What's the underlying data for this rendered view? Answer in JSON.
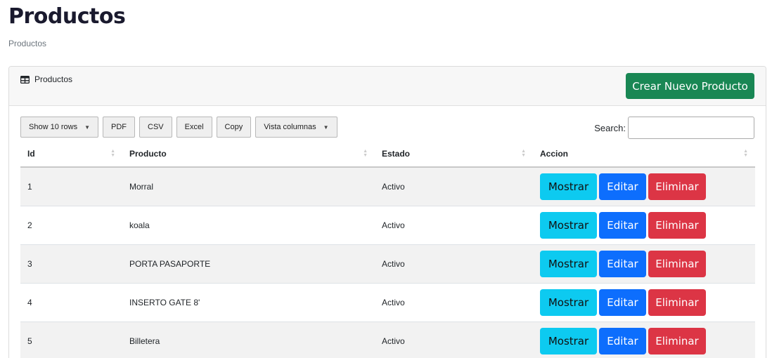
{
  "page": {
    "title": "Productos",
    "breadcrumb": "Productos"
  },
  "card": {
    "header_title": "Productos",
    "create_button": "Crear Nuevo Producto"
  },
  "toolbar": {
    "show_rows": "Show 10 rows",
    "pdf": "PDF",
    "csv": "CSV",
    "excel": "Excel",
    "copy": "Copy",
    "columns": "Vista columnas",
    "search_label": "Search:",
    "search_value": ""
  },
  "table": {
    "headers": [
      "Id",
      "Producto",
      "Estado",
      "Accion"
    ],
    "rows": [
      {
        "id": "1",
        "producto": "Morral",
        "estado": "Activo"
      },
      {
        "id": "2",
        "producto": "koala",
        "estado": "Activo"
      },
      {
        "id": "3",
        "producto": "PORTA PASAPORTE",
        "estado": "Activo"
      },
      {
        "id": "4",
        "producto": "INSERTO GATE 8'",
        "estado": "Activo"
      },
      {
        "id": "5",
        "producto": "Billetera",
        "estado": "Activo"
      }
    ],
    "actions": {
      "show": "Mostrar",
      "edit": "Editar",
      "delete": "Eliminar"
    }
  },
  "colors": {
    "create": "#198754",
    "show": "#0dcaf0",
    "edit": "#0d6efd",
    "delete": "#dc3545"
  }
}
